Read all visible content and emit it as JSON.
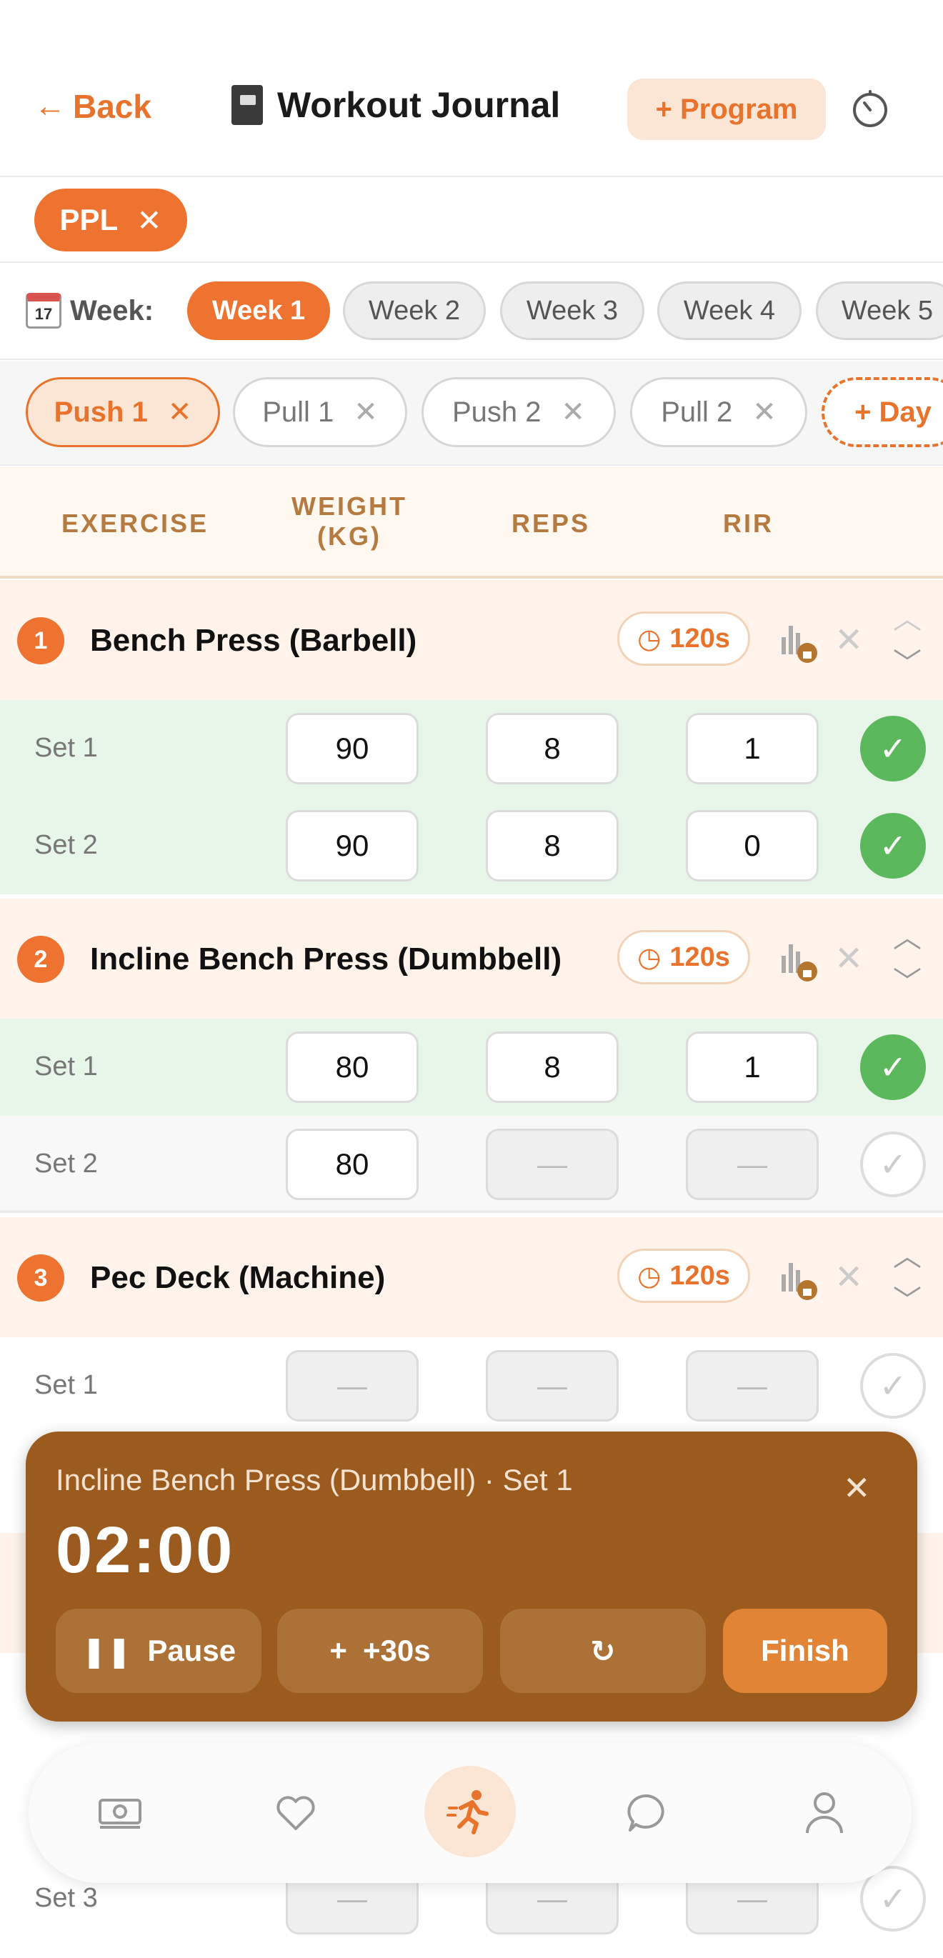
{
  "header": {
    "back_label": "Back",
    "title": "Workout Journal",
    "program_button": "+ Program"
  },
  "program_chip": {
    "label": "PPL"
  },
  "weeks": {
    "label": "Week:",
    "calendar_day": "17",
    "items": [
      "Week 1",
      "Week 2",
      "Week 3",
      "Week 4",
      "Week 5"
    ],
    "active": "Week 1"
  },
  "days": {
    "items": [
      "Push 1",
      "Pull 1",
      "Push 2",
      "Pull 2"
    ],
    "active": "Push 1",
    "add_label": "+ Day"
  },
  "columns": {
    "exercise": "EXERCISE",
    "weight": "WEIGHT (KG)",
    "reps": "REPS",
    "rir": "RIR"
  },
  "exercises": [
    {
      "number": "1",
      "name": "Bench Press (Barbell)",
      "rest": "120s",
      "sets": [
        {
          "label": "Set 1",
          "weight": "90",
          "reps": "8",
          "rir": "1",
          "done": true
        },
        {
          "label": "Set 2",
          "weight": "90",
          "reps": "8",
          "rir": "0",
          "done": true
        }
      ]
    },
    {
      "number": "2",
      "name": "Incline Bench Press (Dumbbell)",
      "rest": "120s",
      "sets": [
        {
          "label": "Set 1",
          "weight": "80",
          "reps": "8",
          "rir": "1",
          "done": true
        },
        {
          "label": "Set 2",
          "weight": "80",
          "reps": "—",
          "rir": "—",
          "done": false
        }
      ]
    },
    {
      "number": "3",
      "name": "Pec Deck (Machine)",
      "rest": "120s",
      "sets": [
        {
          "label": "Set 1",
          "weight": "—",
          "reps": "—",
          "rir": "—",
          "done": false
        }
      ]
    }
  ],
  "hidden_set": {
    "label": "Set 3",
    "weight": "—",
    "reps": "—",
    "rir": "—"
  },
  "rest_timer": {
    "subtitle": "Incline Bench Press (Dumbbell) · Set 1",
    "time": "02:00",
    "pause_label": "Pause",
    "add_label": "+30s",
    "finish_label": "Finish"
  },
  "bottom_nav": {
    "items": [
      "money-icon",
      "heart-icon",
      "workout-runner-icon",
      "chat-icon",
      "profile-icon"
    ],
    "active": "workout-runner-icon"
  },
  "colors": {
    "accent": "#ee7330",
    "done_green": "#5cb85c",
    "timer_bg": "#9b5a1e"
  }
}
